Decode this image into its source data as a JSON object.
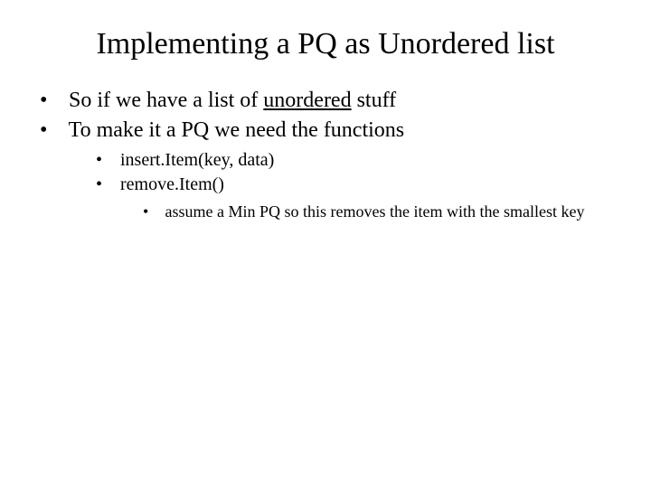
{
  "title": "Implementing a PQ as Unordered list",
  "bullets": {
    "b1_pre": "So if we have a list of ",
    "b1_underlined": "unordered",
    "b1_post": " stuff",
    "b2": "To make it a PQ we need the functions",
    "b2_1": "insert.Item(key, data)",
    "b2_2": "remove.Item()",
    "b2_2_1": "assume a Min PQ so this removes the item with the smallest key"
  }
}
